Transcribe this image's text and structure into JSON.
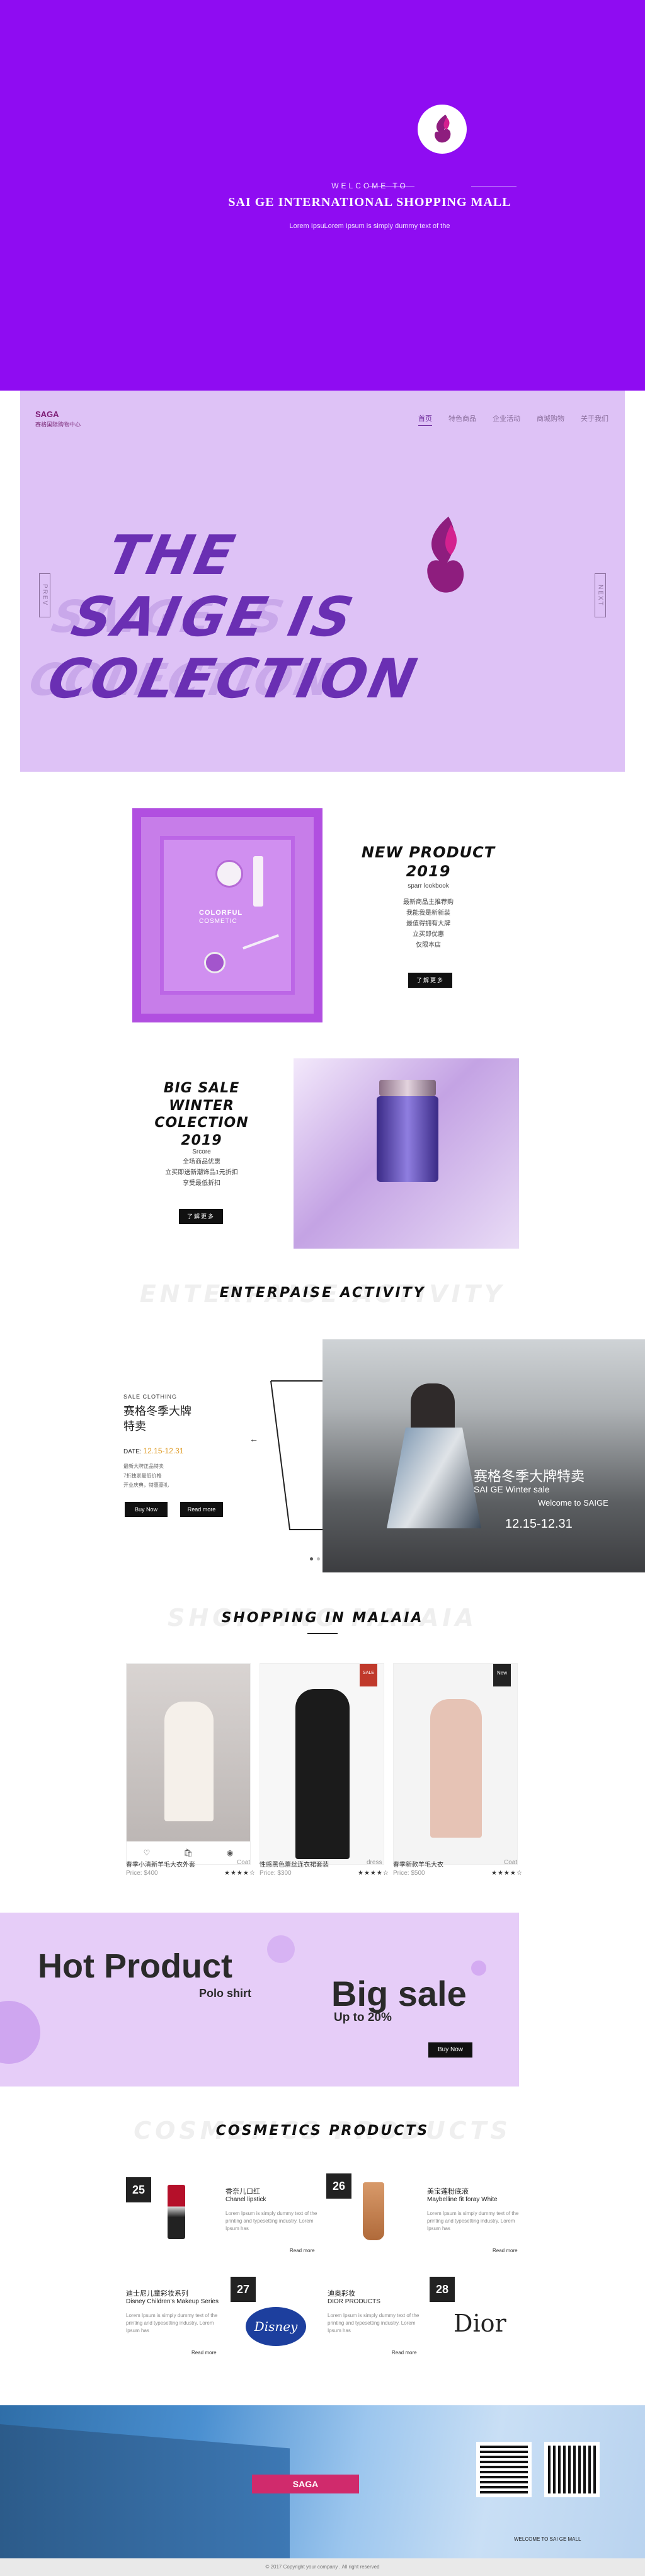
{
  "intro": {
    "welcome": "WELCOME TO",
    "title": "SAI  GE  INTERNATIONAL SHOPPING MALL",
    "sub": "Lorem IpsuLorem Ipsum is simply dummy text of the"
  },
  "hero": {
    "brand": "SAGA",
    "brand_sub": "赛格国际购物中心",
    "nav": [
      "首页",
      "特色商品",
      "企业活动",
      "商城购物",
      "关于我们"
    ],
    "line1": "THE",
    "line2": "SAIGE  IS",
    "line3": "COLECTION",
    "prev": "PREV",
    "next": "NEXT"
  },
  "new_product": {
    "title_1": "NEW PRODUCT",
    "title_2": "2019",
    "en": "sparr lookbook",
    "lines": [
      "最新商品主推荐购",
      "我能我是新新装",
      "最值得拥有大牌",
      "立买即优惠",
      "仅限本店"
    ],
    "button": "了解更多",
    "img_label_1": "COLORFUL",
    "img_label_2": "COSMETIC"
  },
  "big_sale": {
    "title_1": "BIG SALE",
    "title_2": "WINTER COLECTION",
    "title_3": "2019",
    "en": "Srcore",
    "lines": [
      "全场商品优惠",
      "立买即送新潮饰品1元折扣",
      "享受最低折扣"
    ],
    "button": "了解更多"
  },
  "activity": {
    "title": "ENTERPAISE  ACTIVITY",
    "shadow": "ENTERPAISE ACTIVITY",
    "tag": "SALE  CLOTHING",
    "heading": "赛格冬季大牌\n特卖",
    "date_label": "DATE:",
    "date": "12.15-12.31",
    "lines": [
      "最新大牌正品特卖",
      "7折独家最低价格",
      "开业庆典，特惠豪礼"
    ],
    "buy_btn": "Buy Now",
    "read_btn": "Read more",
    "slide_title": "赛格冬季大牌特卖",
    "slide_en": "SAI GE Winter  sale",
    "slide_welcome": "Welcome to SAIGE",
    "slide_date": "12.15-12.31"
  },
  "shopping": {
    "title": "SHOPPING  IN  MALAIA",
    "shadow": "SHOPPING MALAIA",
    "items": [
      {
        "name": "春季小清新羊毛大衣外套",
        "tag": "Coat",
        "price": "Price: $400",
        "stars": "★★★★☆",
        "badge": ""
      },
      {
        "name": "性感黑色蕾丝连衣裙套装",
        "tag": "dress",
        "price": "Price: $300",
        "stars": "★★★★☆",
        "badge": "SALE"
      },
      {
        "name": "春季新款羊毛大衣",
        "tag": "Coat",
        "price": "Price: $500",
        "stars": "★★★★☆",
        "badge": "New"
      }
    ]
  },
  "banner": {
    "hot": "Hot Product",
    "polo": "Polo shirt",
    "big": "Big sale",
    "upto": "Up to 20%",
    "button": "Buy Now"
  },
  "cosmetics": {
    "title": "COSMETICS  PRODUCTS",
    "shadow": "COSMETICS  PRODUCTS",
    "items": [
      {
        "num": "25",
        "cn": "香奈儿口红",
        "en": "Chanel lipstick",
        "desc": "Lorem Ipsum is simply dummy text of the printing and typesetting industry. Lorem Ipsum has",
        "more": "Read more"
      },
      {
        "num": "26",
        "cn": "美宝莲粉底液",
        "en": "Maybelline fit foray White",
        "desc": "Lorem Ipsum is simply dummy text of the printing and typesetting industry. Lorem Ipsum has",
        "more": "Read more"
      },
      {
        "num": "27",
        "cn": "迪士尼儿童彩妆系列",
        "en": "Disney Children's Makeup Series",
        "desc": "Lorem Ipsum is simply dummy text of the printing and typesetting industry. Lorem Ipsum has",
        "more": "Read more"
      },
      {
        "num": "28",
        "cn": "迪奥彩妆",
        "en": "DIOR PRODUCTS",
        "desc": "Lorem Ipsum is simply dummy text of the printing and typesetting industry. Lorem Ipsum has",
        "more": "Read more"
      }
    ],
    "lipstick_label": "CHANEL",
    "disney": "Disney",
    "dior": "Dior"
  },
  "footer": {
    "welcome": "WELCOME TO SAI GE MALL",
    "copyright": "© 2017 Copyright your company . All right reserved"
  },
  "colors": {
    "purple": "#8f0cf2",
    "lilac": "#dec2f6",
    "dark": "#111111"
  }
}
